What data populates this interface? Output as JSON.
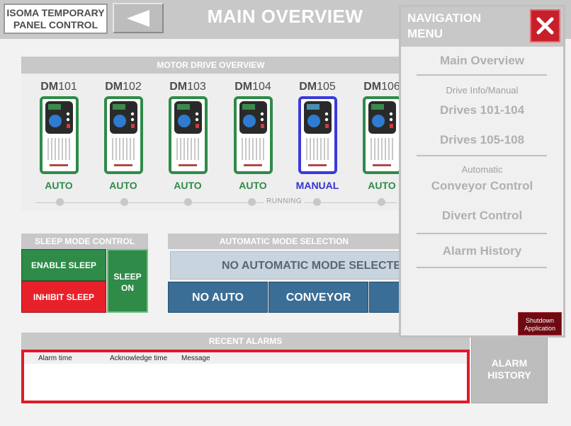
{
  "header": {
    "logo_line1": "ISOMA TEMPORARY",
    "logo_line2": "PANEL CONTROL",
    "title": "MAIN OVERVIEW",
    "back_icon": "back-arrow-icon"
  },
  "motor_drive_overview": {
    "title": "MOTOR DRIVE OVERVIEW",
    "drives": [
      {
        "prefix": "DM",
        "number": "101",
        "mode": "AUTO"
      },
      {
        "prefix": "DM",
        "number": "102",
        "mode": "AUTO"
      },
      {
        "prefix": "DM",
        "number": "103",
        "mode": "AUTO"
      },
      {
        "prefix": "DM",
        "number": "104",
        "mode": "AUTO"
      },
      {
        "prefix": "DM",
        "number": "105",
        "mode": "MANUAL"
      },
      {
        "prefix": "DM",
        "number": "106",
        "mode": "AUTO"
      }
    ],
    "running_label": "RUNNING",
    "colors": {
      "auto": "#2e8b48",
      "manual": "#3333cc"
    }
  },
  "sleep_mode": {
    "title": "SLEEP MODE CONTROL",
    "enable_label": "ENABLE SLEEP",
    "inhibit_label": "INHIBIT SLEEP",
    "status_line1": "SLEEP",
    "status_line2": "ON"
  },
  "auto_mode": {
    "title": "AUTOMATIC MODE SELECTION",
    "status": "NO AUTOMATIC MODE SELECTED",
    "buttons": [
      "NO AUTO",
      "CONVEYOR",
      ""
    ]
  },
  "recent_alarms": {
    "title": "RECENT ALARMS",
    "columns": [
      "Alarm time",
      "Acknowledge time",
      "Message"
    ],
    "rows": []
  },
  "alarm_history_button": {
    "line1": "ALARM",
    "line2": "HISTORY"
  },
  "navigation_menu": {
    "title_line1": "NAVIGATION",
    "title_line2": "MENU",
    "close_icon": "close-icon",
    "main_overview": "Main Overview",
    "drive_info_caption": "Drive Info/Manual",
    "drives_101_104": "Drives 101-104",
    "drives_105_108": "Drives 105-108",
    "automatic_caption": "Automatic",
    "conveyor_control": "Conveyor Control",
    "divert_control": "Divert Control",
    "alarm_history": "Alarm History",
    "shutdown_line1": "Shutdown",
    "shutdown_line2": "Application"
  }
}
